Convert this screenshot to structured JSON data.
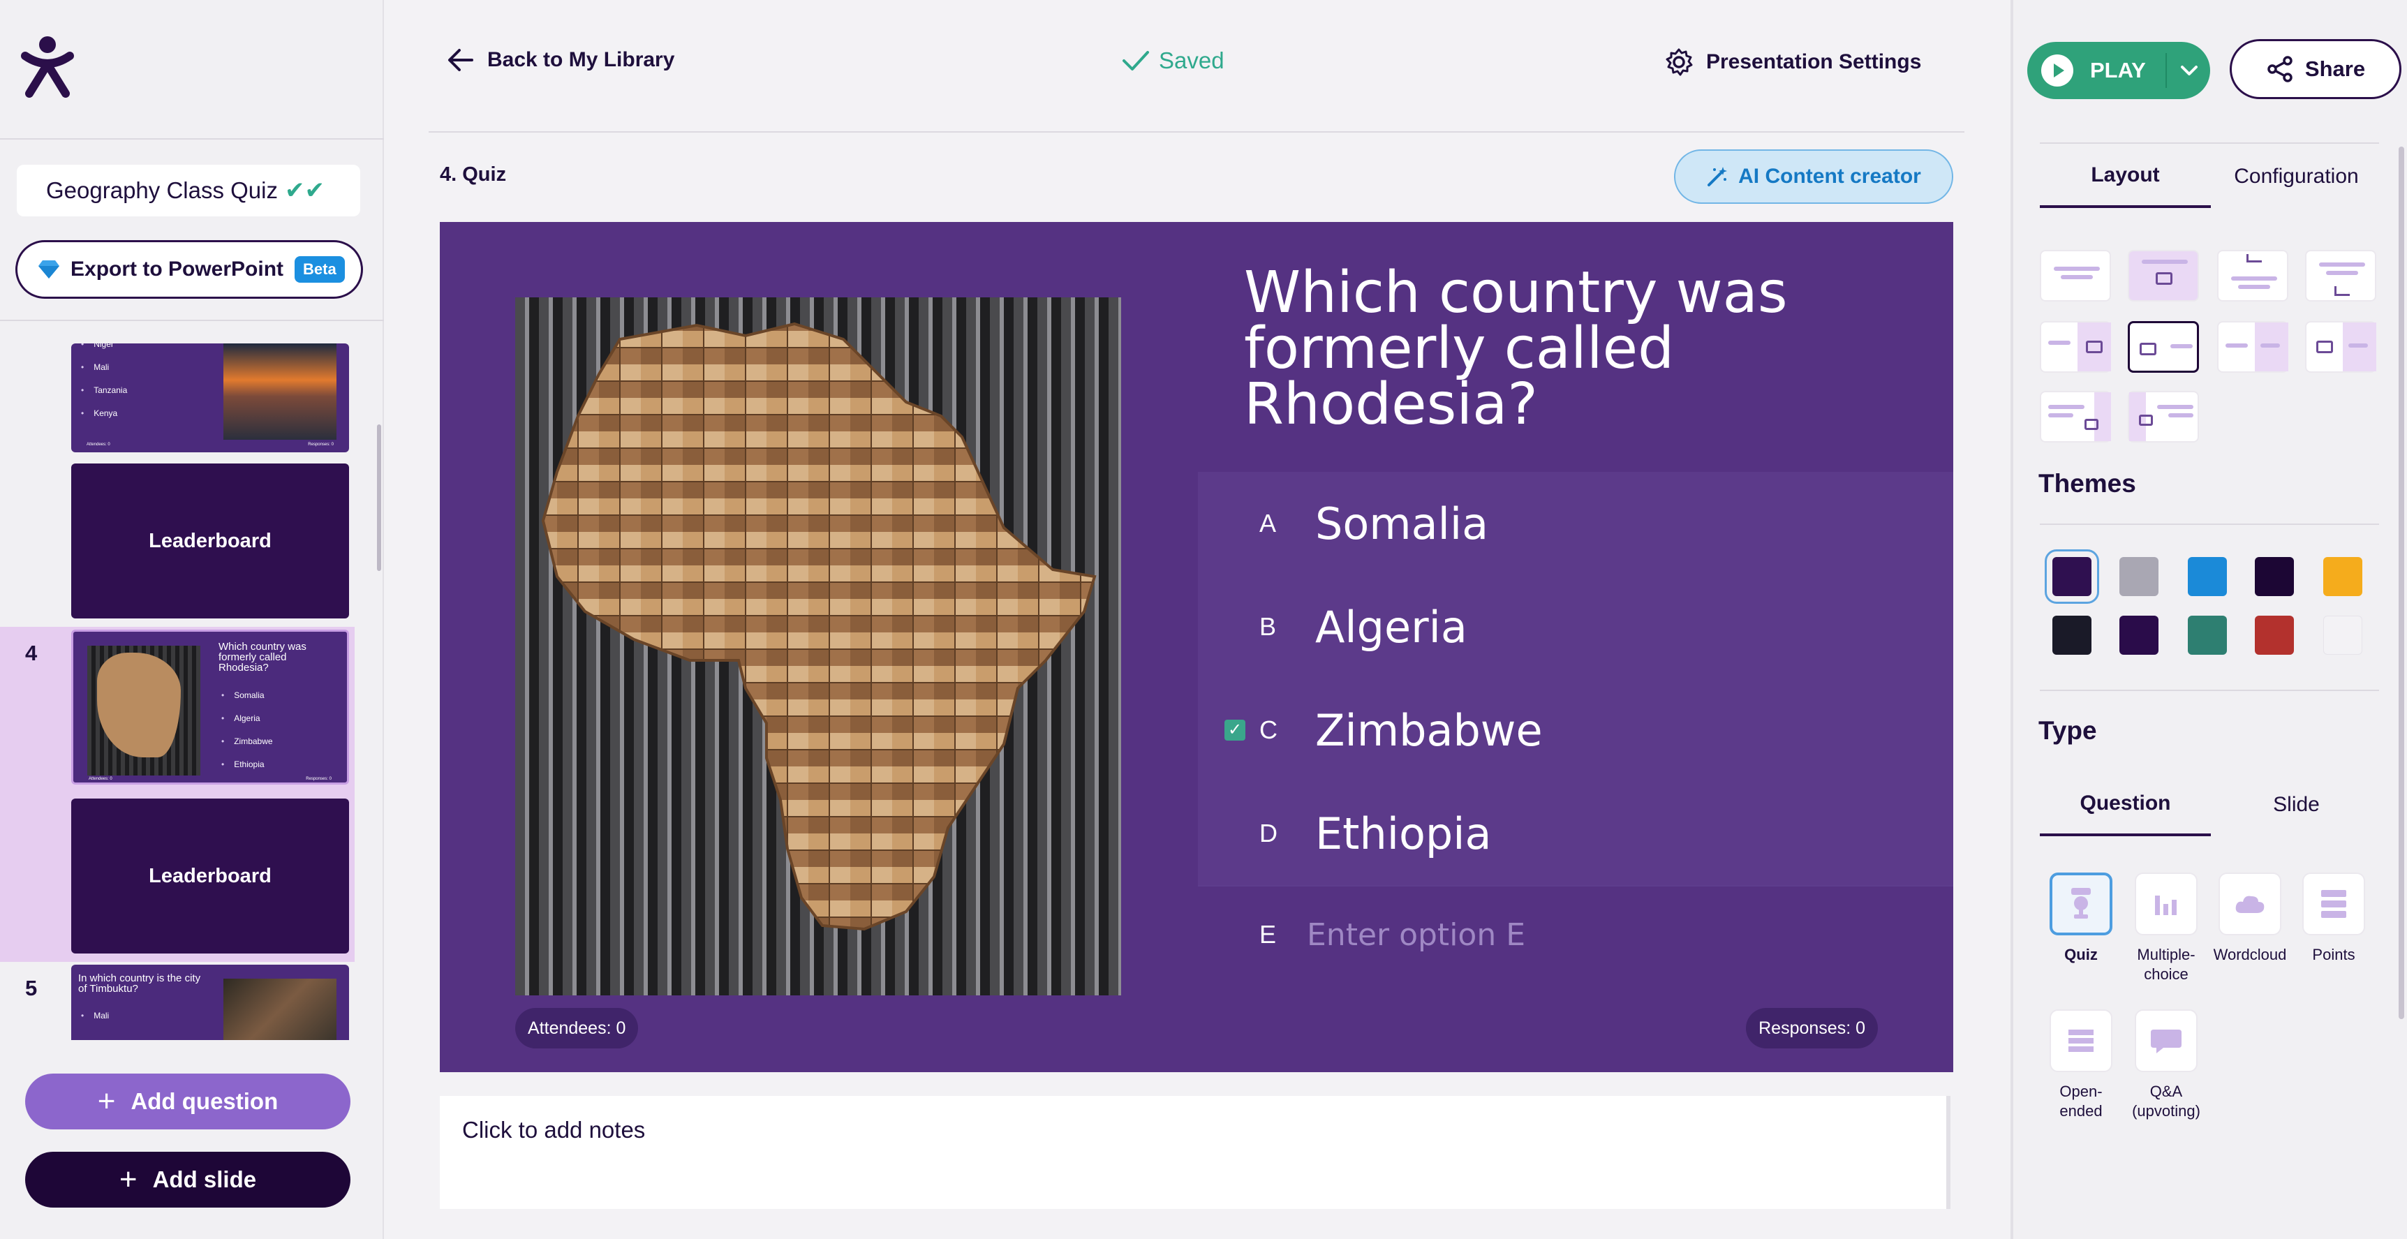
{
  "sidebar": {
    "presentation_title": "Geography Class Quiz",
    "export_label": "Export to PowerPoint",
    "beta_badge": "Beta",
    "slides": {
      "s3_items": [
        "Niger",
        "Mali",
        "Tanzania",
        "Kenya"
      ],
      "s3_footer_left": "Attendees: 0",
      "s3_footer_right": "Responses: 0",
      "leaderboard_label": "Leaderboard",
      "s4_number": "4",
      "s4_question": "Which country was formerly called Rhodesia?",
      "s4_items": [
        "Somalia",
        "Algeria",
        "Zimbabwe",
        "Ethiopia"
      ],
      "s5_number": "5",
      "s5_question": "In which country is the city of Timbuktu?",
      "s5_items": [
        "Mali"
      ]
    },
    "add_question_label": "Add question",
    "add_slide_label": "Add slide"
  },
  "header": {
    "back_label": "Back to My Library",
    "saved_label": "Saved",
    "settings_label": "Presentation Settings"
  },
  "editor": {
    "slide_label": "4. Quiz",
    "ai_button_label": "AI Content creator",
    "question": "Which country was formerly called Rhodesia?",
    "options": [
      {
        "letter": "A",
        "text": "Somalia",
        "correct": false
      },
      {
        "letter": "B",
        "text": "Algeria",
        "correct": false
      },
      {
        "letter": "C",
        "text": "Zimbabwe",
        "correct": true
      },
      {
        "letter": "D",
        "text": "Ethiopia",
        "correct": false
      }
    ],
    "empty_option": {
      "letter": "E",
      "placeholder": "Enter option E"
    },
    "attendees": "Attendees: 0",
    "responses": "Responses: 0",
    "notes_placeholder": "Click to add notes"
  },
  "right_panel": {
    "play_label": "PLAY",
    "share_label": "Share",
    "tabs": [
      "Layout",
      "Configuration"
    ],
    "active_tab": "Layout",
    "themes_heading": "Themes",
    "theme_colors": [
      "#2f1050",
      "#a9a7b3",
      "#1b8ad8",
      "#1c0634",
      "#f5ac1c",
      "#1a1a28",
      "#2a0c4a",
      "#2e7f71",
      "#b3312d",
      "#f3f2f5"
    ],
    "type_heading": "Type",
    "type_tabs": [
      "Question",
      "Slide"
    ],
    "active_type_tab": "Question",
    "question_types": [
      {
        "label": "Quiz",
        "icon": "trophy-icon",
        "selected": true
      },
      {
        "label": "Multiple-choice",
        "icon": "bar-chart-icon",
        "selected": false
      },
      {
        "label": "Wordcloud",
        "icon": "cloud-icon",
        "selected": false
      },
      {
        "label": "Points",
        "icon": "points-icon",
        "selected": false
      },
      {
        "label": "Open-ended",
        "icon": "lines-icon",
        "selected": false
      },
      {
        "label": "Q&A (upvoting)",
        "icon": "chat-icon",
        "selected": false
      }
    ]
  },
  "colors": {
    "brand_dark": "#1e0637",
    "slide_bg": "#553282",
    "accent_green": "#2fa27a",
    "accent_purple": "#8c66cc",
    "ai_blue": "#1579c4"
  }
}
